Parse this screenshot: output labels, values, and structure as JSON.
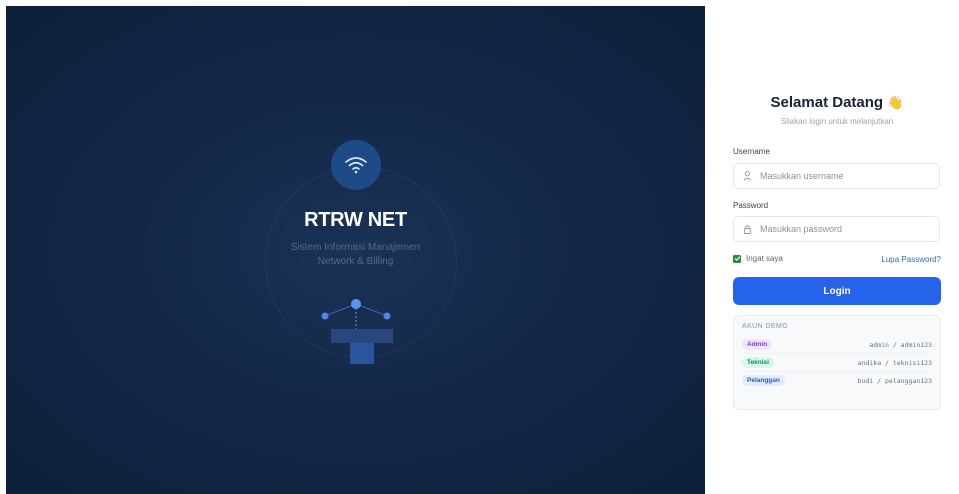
{
  "brand": {
    "name": "RTRW NET",
    "tagline_line1": "Sistem Informasi Manajemen",
    "tagline_line2": "Network & Billing"
  },
  "login": {
    "title": "Selamat Datang",
    "title_emoji": "👋",
    "subtitle": "Silakan login untuk melanjutkan",
    "username_label": "Username",
    "username_placeholder": "Masukkan username",
    "password_label": "Password",
    "password_placeholder": "Masukkan password",
    "remember_label": "Ingat saya",
    "remember_checked": true,
    "forgot_label": "Lupa Password?",
    "submit_label": "Login"
  },
  "demo": {
    "title": "AKUN DEMO",
    "accounts": [
      {
        "role": "Admin",
        "credentials": "admin / admin123",
        "color": "#7c3aed",
        "bg": "#efe7fd"
      },
      {
        "role": "Teknisi",
        "credentials": "andika / teknisi123",
        "color": "#0f8a5f",
        "bg": "#daf5ea"
      },
      {
        "role": "Pelanggan",
        "credentials": "budi / pelanggan123",
        "color": "#2b59c3",
        "bg": "#e3ebfb"
      }
    ]
  },
  "colors": {
    "accent": "#2563eb",
    "panel_dark": "#132847",
    "brand_icon_bg": "#1e4a86",
    "checkbox_green": "#2f8a3b"
  },
  "icons": {
    "brand": "wifi-icon",
    "username": "user-icon",
    "password": "lock-icon",
    "illustration": "network-topology-icon"
  }
}
